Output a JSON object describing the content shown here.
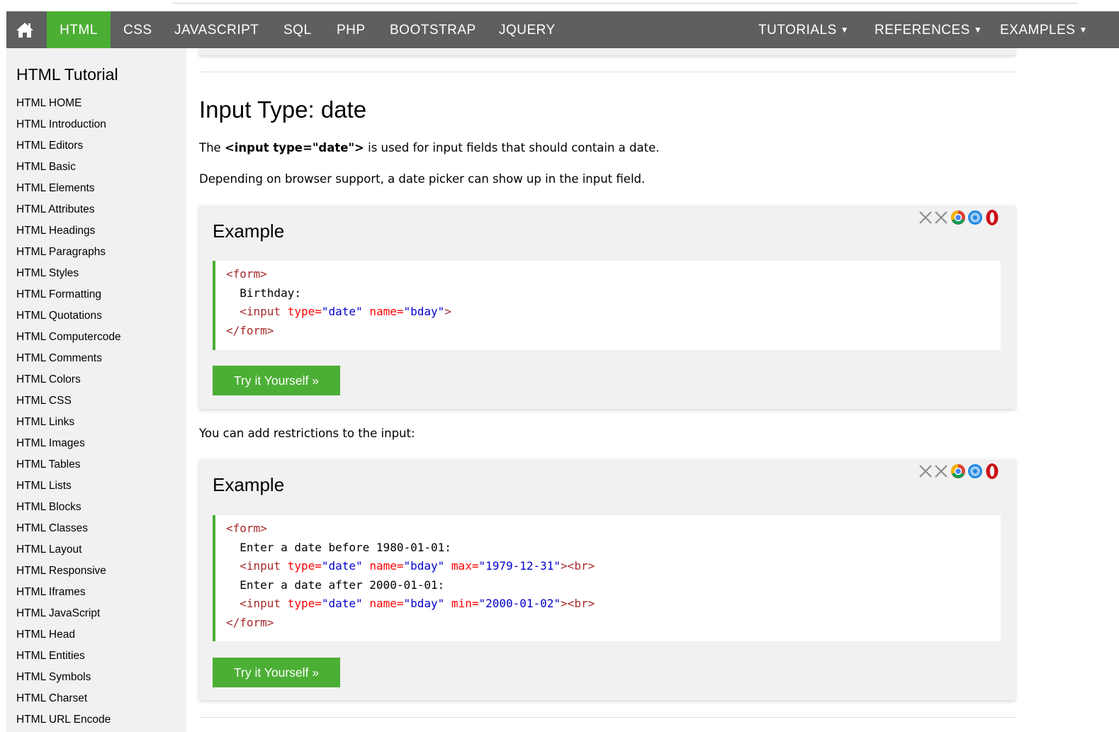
{
  "nav": {
    "home_icon": "home-icon",
    "items": [
      "HTML",
      "CSS",
      "JAVASCRIPT",
      "SQL",
      "PHP",
      "BOOTSTRAP",
      "JQUERY"
    ],
    "dropdowns": [
      "TUTORIALS",
      "REFERENCES",
      "EXAMPLES"
    ],
    "active": "HTML"
  },
  "sidebar": {
    "title": "HTML Tutorial",
    "items": [
      "HTML HOME",
      "HTML Introduction",
      "HTML Editors",
      "HTML Basic",
      "HTML Elements",
      "HTML Attributes",
      "HTML Headings",
      "HTML Paragraphs",
      "HTML Styles",
      "HTML Formatting",
      "HTML Quotations",
      "HTML Computercode",
      "HTML Comments",
      "HTML Colors",
      "HTML CSS",
      "HTML Links",
      "HTML Images",
      "HTML Tables",
      "HTML Lists",
      "HTML Blocks",
      "HTML Classes",
      "HTML Layout",
      "HTML Responsive",
      "HTML Iframes",
      "HTML JavaScript",
      "HTML Head",
      "HTML Entities",
      "HTML Symbols",
      "HTML Charset",
      "HTML URL Encode"
    ]
  },
  "main": {
    "title": "Input Type: date",
    "intro_prefix": "The ",
    "intro_code": "<input type=\"date\">",
    "intro_suffix": " is used for input fields that should contain a date.",
    "intro2": "Depending on browser support, a date picker can show up in the input field.",
    "restrictions_text": "You can add restrictions to the input:",
    "examples": [
      {
        "title": "Example",
        "button": "Try it Yourself »",
        "browser_icons": [
          "edge-unsupported-icon",
          "firefox-unsupported-icon",
          "chrome-icon",
          "safari-icon",
          "opera-icon"
        ],
        "code": {
          "form_open": "<form>",
          "line1": "Birthday:",
          "input_open": "<input",
          "attr_type": "type=",
          "val_type": "\"date\"",
          "attr_name": "name=",
          "val_name": "\"bday\"",
          "input_close": ">",
          "form_close": "</form>"
        }
      },
      {
        "title": "Example",
        "button": "Try it Yourself »",
        "browser_icons": [
          "edge-unsupported-icon",
          "firefox-unsupported-icon",
          "chrome-icon",
          "safari-icon",
          "opera-icon"
        ],
        "code": {
          "form_open": "<form>",
          "line1": "Enter a date before 1980-01-01:",
          "input_open": "<input",
          "attr_type": "type=",
          "val_type": "\"date\"",
          "attr_name": "name=",
          "val_name": "\"bday\"",
          "attr_max": "max=",
          "val_max": "\"1979-12-31\"",
          "close_br": "><br>",
          "line2": "Enter a date after 2000-01-01:",
          "attr_min": "min=",
          "val_min": "\"2000-01-02\"",
          "form_close": "</form>"
        }
      }
    ]
  },
  "colors": {
    "nav_bg": "#5f5f5f",
    "accent": "#4caf35",
    "panel_bg": "#f1f1f1"
  }
}
